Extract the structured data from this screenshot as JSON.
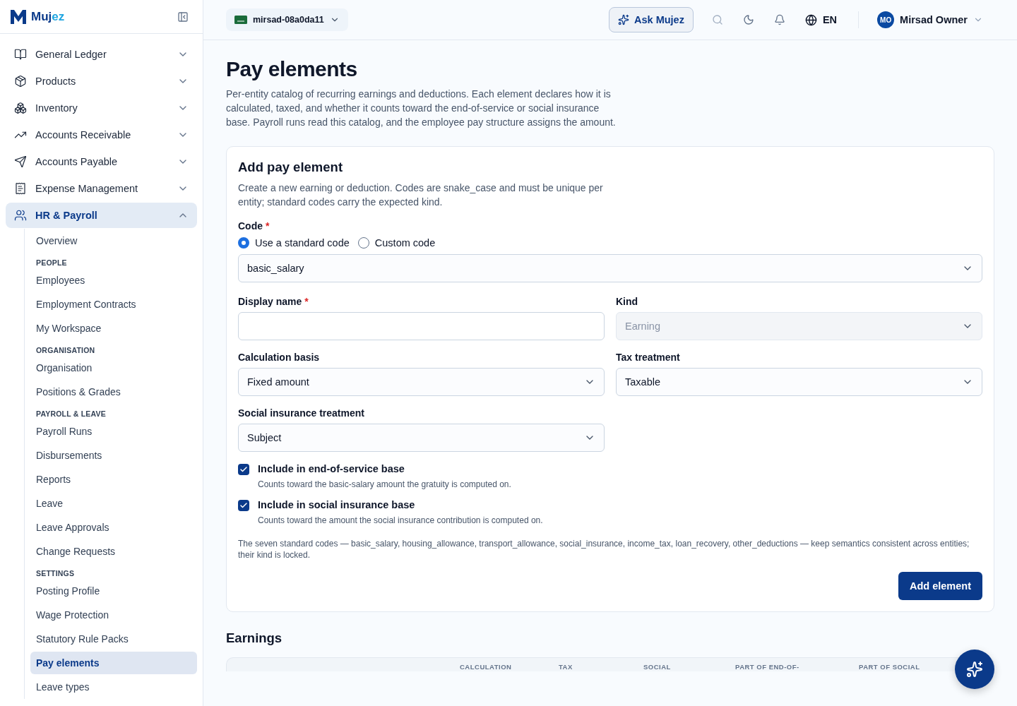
{
  "brand": {
    "name_a": "Muj",
    "name_b": "ez"
  },
  "org": {
    "name": "mirsad-08a0da11"
  },
  "topbar": {
    "ask": "Ask Mujez",
    "language": "EN",
    "user_initials": "MO",
    "user_name": "Mirsad Owner"
  },
  "sidebar": {
    "items": [
      {
        "label": "General Ledger",
        "expanded": false,
        "selected": false
      },
      {
        "label": "Products",
        "expanded": false,
        "selected": false
      },
      {
        "label": "Inventory",
        "expanded": false,
        "selected": false
      },
      {
        "label": "Accounts Receivable",
        "expanded": false,
        "selected": false
      },
      {
        "label": "Accounts Payable",
        "expanded": false,
        "selected": false
      },
      {
        "label": "Expense Management",
        "expanded": false,
        "selected": false
      },
      {
        "label": "HR & Payroll",
        "expanded": true,
        "selected": true,
        "children": [
          {
            "kind": "link",
            "label": "Overview",
            "selected": false
          },
          {
            "kind": "section",
            "label": "PEOPLE"
          },
          {
            "kind": "link",
            "label": "Employees",
            "selected": false
          },
          {
            "kind": "link",
            "label": "Employment Contracts",
            "selected": false
          },
          {
            "kind": "link",
            "label": "My Workspace",
            "selected": false
          },
          {
            "kind": "section",
            "label": "ORGANISATION"
          },
          {
            "kind": "link",
            "label": "Organisation",
            "selected": false
          },
          {
            "kind": "link",
            "label": "Positions & Grades",
            "selected": false
          },
          {
            "kind": "section",
            "label": "PAYROLL & LEAVE"
          },
          {
            "kind": "link",
            "label": "Payroll Runs",
            "selected": false
          },
          {
            "kind": "link",
            "label": "Disbursements",
            "selected": false
          },
          {
            "kind": "link",
            "label": "Reports",
            "selected": false
          },
          {
            "kind": "link",
            "label": "Leave",
            "selected": false
          },
          {
            "kind": "link",
            "label": "Leave Approvals",
            "selected": false
          },
          {
            "kind": "link",
            "label": "Change Requests",
            "selected": false
          },
          {
            "kind": "section",
            "label": "SETTINGS"
          },
          {
            "kind": "link",
            "label": "Posting Profile",
            "selected": false
          },
          {
            "kind": "link",
            "label": "Wage Protection",
            "selected": false
          },
          {
            "kind": "link",
            "label": "Statutory Rule Packs",
            "selected": false
          },
          {
            "kind": "link",
            "label": "Pay elements",
            "selected": true
          },
          {
            "kind": "link",
            "label": "Leave types",
            "selected": false
          }
        ]
      }
    ]
  },
  "page": {
    "title": "Pay elements",
    "description": "Per-entity catalog of recurring earnings and deductions. Each element declares how it is calculated, taxed, and whether it counts toward the end-of-service or social insurance base. Payroll runs read this catalog, and the employee pay structure assigns the amount."
  },
  "form": {
    "title": "Add pay element",
    "description": "Create a new earning or deduction. Codes are snake_case and must be unique per entity; standard codes carry the expected kind.",
    "code_label": "Code",
    "code_required_mark": "*",
    "code_options": [
      {
        "label": "Use a standard code",
        "selected": true
      },
      {
        "label": "Custom code",
        "selected": false
      }
    ],
    "code_value": "basic_salary",
    "fields": [
      {
        "kind": "input",
        "label": "Display name",
        "required_mark": "*"
      },
      {
        "kind": "select",
        "label": "Kind",
        "value": "Earning",
        "disabled": true
      },
      {
        "kind": "select",
        "label": "Calculation basis",
        "value": "Fixed amount",
        "disabled": false
      },
      {
        "kind": "select",
        "label": "Tax treatment",
        "value": "Taxable",
        "disabled": false
      },
      {
        "kind": "select",
        "label": "Social insurance treatment",
        "value": "Subject",
        "disabled": false
      }
    ],
    "checkboxes": [
      {
        "label": "Include in end-of-service base",
        "hint": "Counts toward the basic-salary amount the gratuity is computed on.",
        "checked": true
      },
      {
        "label": "Include in social insurance base",
        "hint": "Counts toward the amount the social insurance contribution is computed on.",
        "checked": true
      }
    ],
    "note": "The seven standard codes — basic_salary, housing_allowance, transport_allowance, social_insurance, income_tax, loan_recovery, other_deductions — keep semantics consistent across entities; their kind is locked.",
    "submit": "Add element"
  },
  "earnings": {
    "title": "Earnings",
    "columns": [
      "CALCULATION",
      "TAX",
      "SOCIAL",
      "PART OF END-OF-",
      "PART OF SOCIAL"
    ]
  }
}
